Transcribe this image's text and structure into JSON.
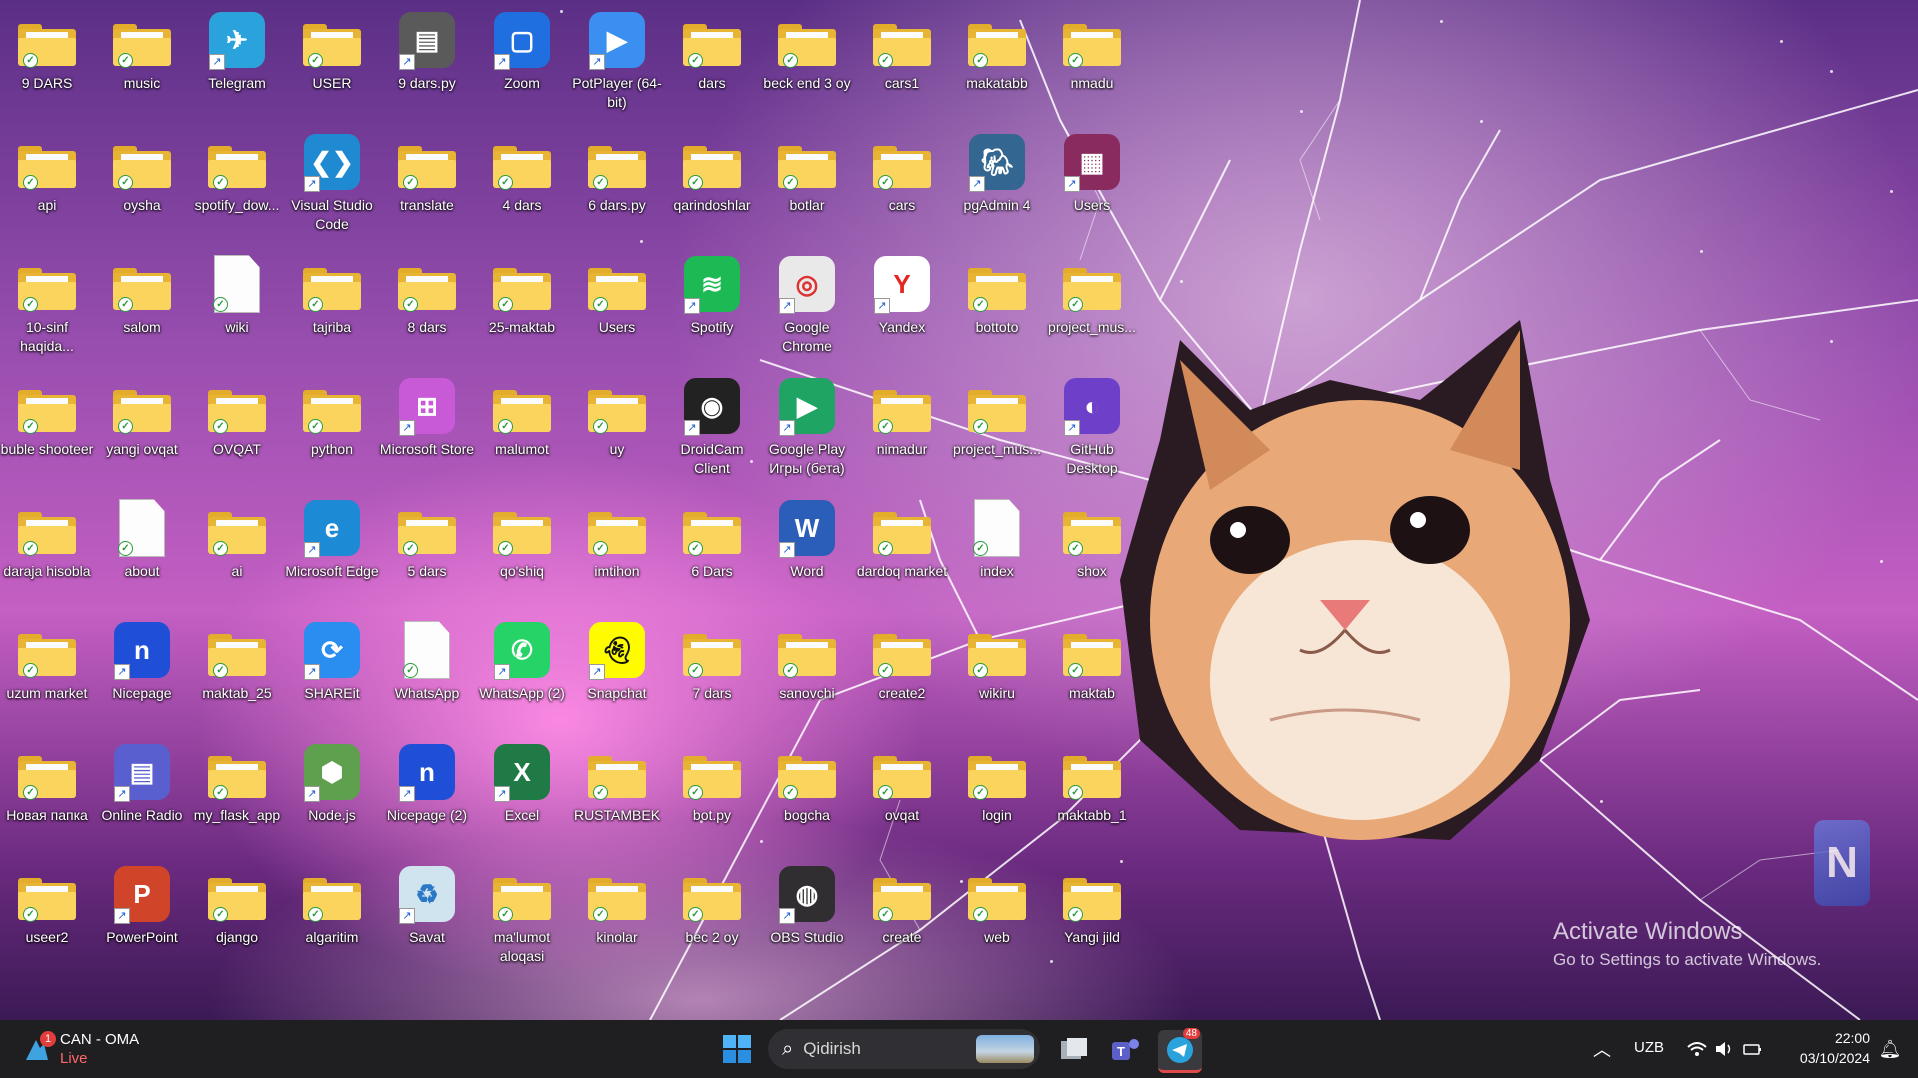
{
  "desktop": {
    "icons": [
      {
        "label": "9 DARS",
        "type": "folder"
      },
      {
        "label": "music",
        "type": "folder"
      },
      {
        "label": "Telegram",
        "type": "app",
        "icon": "telegram-icon",
        "color": "#2aa3dd"
      },
      {
        "label": "USER",
        "type": "folder"
      },
      {
        "label": "9 dars.py",
        "type": "app",
        "icon": "drive-icon",
        "color": "#5a5a5a"
      },
      {
        "label": "Zoom",
        "type": "app",
        "icon": "zoom-icon",
        "color": "#1f6fe0"
      },
      {
        "label": "PotPlayer (64-bit)",
        "type": "app",
        "icon": "potplayer-icon",
        "color": "#3a8ff0"
      },
      {
        "label": "dars",
        "type": "folder"
      },
      {
        "label": "beck end 3 oy",
        "type": "folder"
      },
      {
        "label": "cars1",
        "type": "folder"
      },
      {
        "label": "makatabb",
        "type": "folder"
      },
      {
        "label": "nmadu",
        "type": "folder"
      },
      {
        "label": "api",
        "type": "folder"
      },
      {
        "label": "oysha",
        "type": "folder"
      },
      {
        "label": "spotify_dow...",
        "type": "folder"
      },
      {
        "label": "Visual Studio Code",
        "type": "app",
        "icon": "vscode-icon",
        "color": "#1f8ad2"
      },
      {
        "label": "translate",
        "type": "folder"
      },
      {
        "label": "4 dars",
        "type": "folder"
      },
      {
        "label": "6 dars.py",
        "type": "folder"
      },
      {
        "label": "qarindoshlar",
        "type": "folder"
      },
      {
        "label": "botlar",
        "type": "folder"
      },
      {
        "label": "cars",
        "type": "folder"
      },
      {
        "label": "pgAdmin 4",
        "type": "app",
        "icon": "pgadmin-icon",
        "color": "#336791"
      },
      {
        "label": "Users",
        "type": "app",
        "icon": "winrar-icon",
        "color": "#8a2b5f"
      },
      {
        "label": "10-sinf haqida...",
        "type": "folder"
      },
      {
        "label": "salom",
        "type": "folder"
      },
      {
        "label": "wiki",
        "type": "file"
      },
      {
        "label": "tajriba",
        "type": "folder"
      },
      {
        "label": "8 dars",
        "type": "folder"
      },
      {
        "label": "25-maktab",
        "type": "folder"
      },
      {
        "label": "Users",
        "type": "folder"
      },
      {
        "label": "Spotify",
        "type": "app",
        "icon": "spotify-icon",
        "color": "#1db954"
      },
      {
        "label": "Google Chrome",
        "type": "app",
        "icon": "chrome-icon",
        "color": "#e9e9e9"
      },
      {
        "label": "Yandex",
        "type": "app",
        "icon": "yandex-icon",
        "color": "#ffffff"
      },
      {
        "label": "bottoto",
        "type": "folder"
      },
      {
        "label": "project_mus...",
        "type": "folder"
      },
      {
        "label": "buble shooteer",
        "type": "folder"
      },
      {
        "label": "yangi ovqat",
        "type": "folder"
      },
      {
        "label": "OVQAT",
        "type": "folder"
      },
      {
        "label": "python",
        "type": "folder"
      },
      {
        "label": "Microsoft Store",
        "type": "app",
        "icon": "store-icon",
        "color": "#c85ad8"
      },
      {
        "label": "malumot",
        "type": "folder"
      },
      {
        "label": "uy",
        "type": "folder"
      },
      {
        "label": "DroidCam Client",
        "type": "app",
        "icon": "droidcam-icon",
        "color": "#222222"
      },
      {
        "label": "Google Play Игры (бета)",
        "type": "app",
        "icon": "playgames-icon",
        "color": "#1fa463"
      },
      {
        "label": "nimadur",
        "type": "folder"
      },
      {
        "label": "project_mus...",
        "type": "folder"
      },
      {
        "label": "GitHub Desktop",
        "type": "app",
        "icon": "github-icon",
        "color": "#6e40c9"
      },
      {
        "label": "daraja hisobla",
        "type": "folder"
      },
      {
        "label": "about",
        "type": "file"
      },
      {
        "label": "ai",
        "type": "folder"
      },
      {
        "label": "Microsoft Edge",
        "type": "app",
        "icon": "edge-icon",
        "color": "#1d8ad6"
      },
      {
        "label": "5 dars",
        "type": "folder"
      },
      {
        "label": "qo'shiq",
        "type": "folder"
      },
      {
        "label": "imtihon",
        "type": "folder"
      },
      {
        "label": "6 Dars",
        "type": "folder"
      },
      {
        "label": "Word",
        "type": "app",
        "icon": "word-icon",
        "color": "#2b5eb8"
      },
      {
        "label": "dardoq market",
        "type": "folder"
      },
      {
        "label": "index",
        "type": "file"
      },
      {
        "label": "shox",
        "type": "folder"
      },
      {
        "label": "uzum market",
        "type": "folder"
      },
      {
        "label": "Nicepage",
        "type": "app",
        "icon": "nicepage-icon",
        "color": "#1f4fd6"
      },
      {
        "label": "maktab_25",
        "type": "folder"
      },
      {
        "label": "SHAREit",
        "type": "app",
        "icon": "shareit-icon",
        "color": "#2a8df0"
      },
      {
        "label": "WhatsApp",
        "type": "file"
      },
      {
        "label": "WhatsApp (2)",
        "type": "app",
        "icon": "whatsapp-icon",
        "color": "#25d366"
      },
      {
        "label": "Snapchat",
        "type": "app",
        "icon": "snapchat-icon",
        "color": "#fffc00"
      },
      {
        "label": "7 dars",
        "type": "folder"
      },
      {
        "label": "sanovchi",
        "type": "folder"
      },
      {
        "label": "create2",
        "type": "folder"
      },
      {
        "label": "wikiru",
        "type": "folder"
      },
      {
        "label": "maktab",
        "type": "folder"
      },
      {
        "label": "Новая папка",
        "type": "folder"
      },
      {
        "label": "Online Radio",
        "type": "app",
        "icon": "radio-icon",
        "color": "#5a5fcf"
      },
      {
        "label": "my_flask_app",
        "type": "folder"
      },
      {
        "label": "Node.js",
        "type": "app",
        "icon": "nodejs-icon",
        "color": "#5fa04e"
      },
      {
        "label": "Nicepage (2)",
        "type": "app",
        "icon": "nicepage-icon",
        "color": "#1f4fd6"
      },
      {
        "label": "Excel",
        "type": "app",
        "icon": "excel-icon",
        "color": "#1f7a45"
      },
      {
        "label": "RUSTAMBEK",
        "type": "folder"
      },
      {
        "label": "bot.py",
        "type": "folder"
      },
      {
        "label": "bogcha",
        "type": "folder"
      },
      {
        "label": "ovqat",
        "type": "folder"
      },
      {
        "label": "login",
        "type": "folder"
      },
      {
        "label": "maktabb_1",
        "type": "folder"
      },
      {
        "label": "useer2",
        "type": "folder"
      },
      {
        "label": "PowerPoint",
        "type": "app",
        "icon": "powerpoint-icon",
        "color": "#d0442a"
      },
      {
        "label": "django",
        "type": "folder"
      },
      {
        "label": "algaritim",
        "type": "folder"
      },
      {
        "label": "Savat",
        "type": "app",
        "icon": "recycle-bin-icon",
        "color": "#d0e4f0"
      },
      {
        "label": "ma'lumot aloqasi",
        "type": "folder"
      },
      {
        "label": "kinolar",
        "type": "folder"
      },
      {
        "label": "bec 2 oy",
        "type": "folder"
      },
      {
        "label": "OBS Studio",
        "type": "app",
        "icon": "obs-icon",
        "color": "#302e31"
      },
      {
        "label": "create",
        "type": "folder"
      },
      {
        "label": "web",
        "type": "folder"
      },
      {
        "label": "Yangi jild",
        "type": "folder"
      }
    ]
  },
  "watermark": {
    "line1": "Activate Windows",
    "line2": "Go to Settings to activate Windows."
  },
  "taskbar": {
    "weather": {
      "badge": "1",
      "title": "CAN - OMA",
      "subtitle": "Live"
    },
    "search_placeholder": "Qidirish",
    "telegram_badge": "48",
    "language": "UZB",
    "time": "22:00",
    "date": "03/10/2024"
  }
}
